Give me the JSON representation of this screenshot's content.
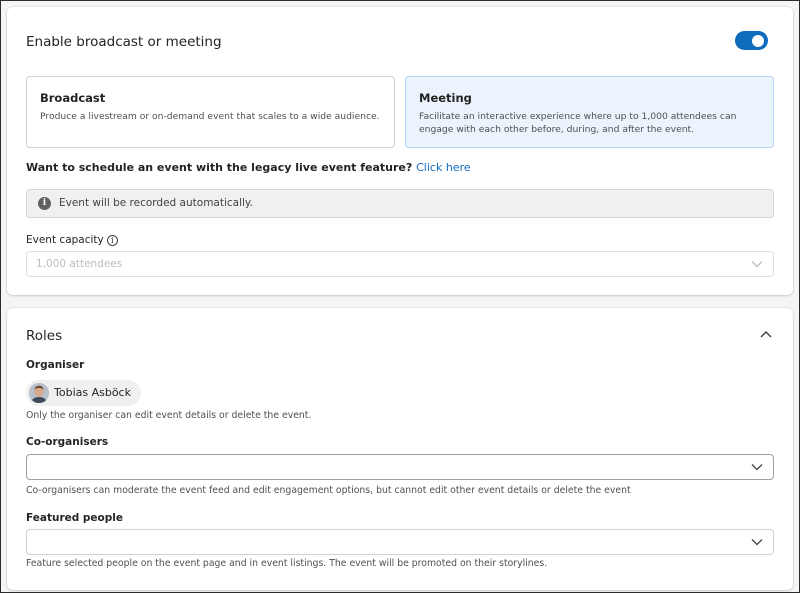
{
  "broadcast_card": {
    "title": "Enable broadcast or meeting",
    "toggle_on": true,
    "options": [
      {
        "title": "Broadcast",
        "desc": "Produce a livestream or on-demand event that scales to a wide audience.",
        "selected": false
      },
      {
        "title": "Meeting",
        "desc": "Facilitate an interactive experience where up to 1,000 attendees can engage with each other before, during, and after the event.",
        "selected": true
      }
    ],
    "legacy_prompt": "Want to schedule an event with the legacy live event feature?",
    "legacy_link": "Click here",
    "info_message": "Event will be recorded automatically.",
    "capacity_label": "Event capacity",
    "capacity_value": "1,000 attendees"
  },
  "roles": {
    "title": "Roles",
    "organiser_label": "Organiser",
    "organiser_name": "Tobias Asböck",
    "organiser_help": "Only the organiser can edit event details or delete the event.",
    "coorganisers_label": "Co-organisers",
    "coorganisers_value": "",
    "coorganisers_help": "Co-organisers can moderate the event feed and edit engagement options, but cannot edit other event details or delete the event",
    "featured_label": "Featured people",
    "featured_value": "",
    "featured_help": "Feature selected people on the event page and in event listings. The event will be promoted on their storylines."
  },
  "colors": {
    "accent": "#0f6cbd",
    "selected_bg": "#ebf3fc",
    "selected_border": "#b4d6fa"
  }
}
